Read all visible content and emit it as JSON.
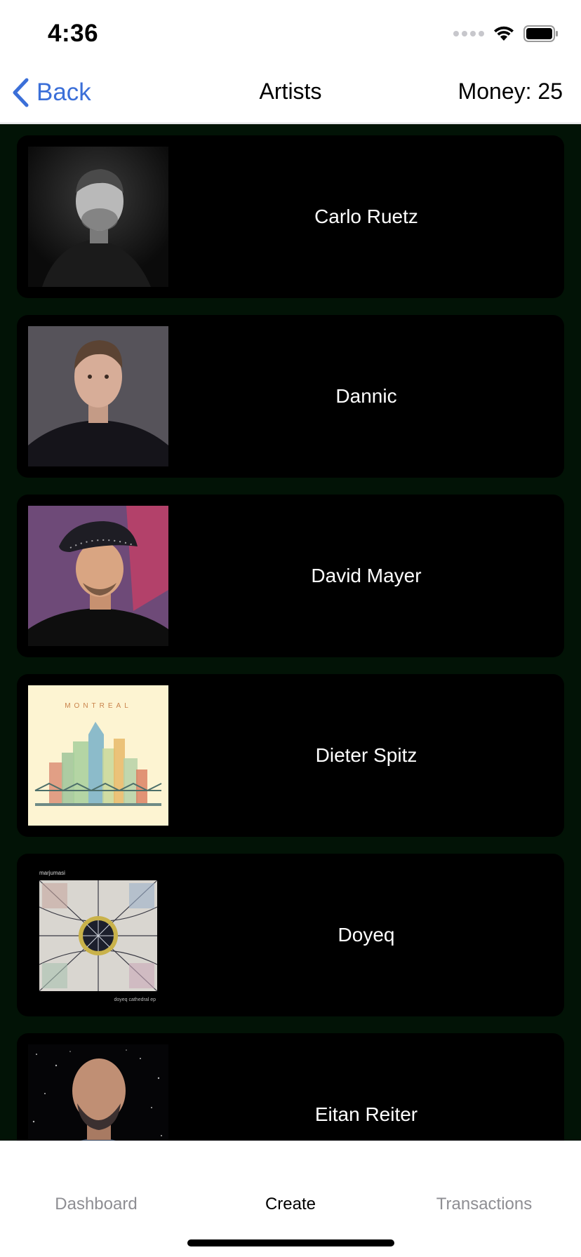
{
  "status_bar": {
    "time": "4:36"
  },
  "nav": {
    "back_label": "Back",
    "title": "Artists",
    "money": "Money: 25"
  },
  "artists": [
    {
      "name": "Carlo Ruetz"
    },
    {
      "name": "Dannic"
    },
    {
      "name": "David Mayer"
    },
    {
      "name": "Dieter Spitz"
    },
    {
      "name": "Doyeq"
    },
    {
      "name": "Eitan Reiter"
    }
  ],
  "album_text": {
    "montreal": "MONTREAL",
    "label": "marjumasi",
    "credit": "doyeq cathedral ep"
  },
  "tabs": [
    {
      "label": "Dashboard"
    },
    {
      "label": "Create"
    },
    {
      "label": "Transactions"
    }
  ],
  "colors": {
    "accent": "#3b6fd8",
    "background": "#021306",
    "card": "#000000"
  }
}
